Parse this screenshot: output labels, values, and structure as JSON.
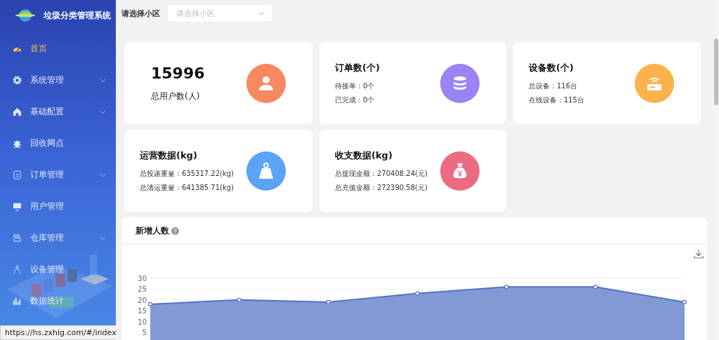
{
  "app": {
    "title": "垃圾分类管理系统"
  },
  "sidebar": {
    "items": [
      {
        "label": "首页",
        "selected": true,
        "expandable": false
      },
      {
        "label": "系统管理",
        "selected": false,
        "expandable": true
      },
      {
        "label": "基础配置",
        "selected": false,
        "expandable": true
      },
      {
        "label": "回收网点",
        "selected": false,
        "expandable": false
      },
      {
        "label": "订单管理",
        "selected": false,
        "expandable": true
      },
      {
        "label": "用户管理",
        "selected": false,
        "expandable": false
      },
      {
        "label": "仓库管理",
        "selected": false,
        "expandable": true
      },
      {
        "label": "设备管理",
        "selected": false,
        "expandable": false
      },
      {
        "label": "数据统计",
        "selected": false,
        "expandable": false
      }
    ]
  },
  "filter": {
    "label": "请选择小区",
    "placeholder": "请选择小区"
  },
  "cards": [
    {
      "kind": "total",
      "value": "15996",
      "label": "总用户数(人)",
      "color": "#f7885f"
    },
    {
      "kind": "stats",
      "title": "订单数(个)",
      "lines": [
        "待接单：0个",
        "已完成：0个"
      ],
      "color": "#9a83f2"
    },
    {
      "kind": "stats",
      "title": "设备数(个)",
      "lines": [
        "总设备：116台",
        "在线设备：115台"
      ],
      "color": "#fbb24a"
    },
    {
      "kind": "stats",
      "title": "运营数据(kg)",
      "lines": [
        "总投递重量：635317.22(kg)",
        "总清运重量：641385.71(kg)"
      ],
      "color": "#5aa3f5"
    },
    {
      "kind": "stats",
      "title": "收支数据(kg)",
      "lines": [
        "总提现金额：270408.24(元)",
        "总充值金额：272390.58(元)"
      ],
      "color": "#ea6b82"
    }
  ],
  "panel": {
    "title": "新增人数",
    "chart_data": {
      "type": "area",
      "series": [
        {
          "color": "#8399d6",
          "values": [
            18,
            20,
            19,
            23,
            26,
            26,
            19
          ]
        }
      ],
      "ylim": [
        0,
        30
      ],
      "yticks": [
        5,
        10,
        15,
        20,
        25,
        30
      ]
    }
  },
  "status_bar": {
    "url": "https://hs.zxhig.com/#/index"
  }
}
